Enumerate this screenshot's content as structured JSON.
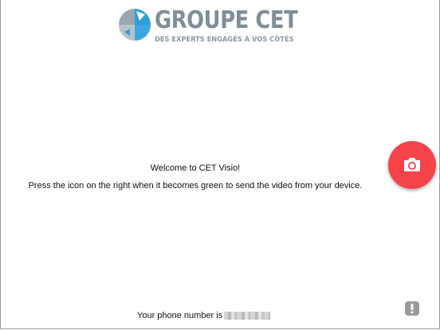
{
  "logo": {
    "name": "GROUPE CET",
    "tagline": "DES EXPERTS ENGAGÉS À VOS CÔTÉS"
  },
  "main": {
    "welcome": "Welcome to CET Visio!",
    "instructions": "Press the icon on the right when it becomes green to send the video from your device.",
    "phone_label": "Your phone number is"
  },
  "camera_button": {
    "icon": "camera-icon",
    "color": "#f5434a"
  },
  "alert_button": {
    "icon": "exclamation-icon",
    "color": "#9a9a9a"
  }
}
